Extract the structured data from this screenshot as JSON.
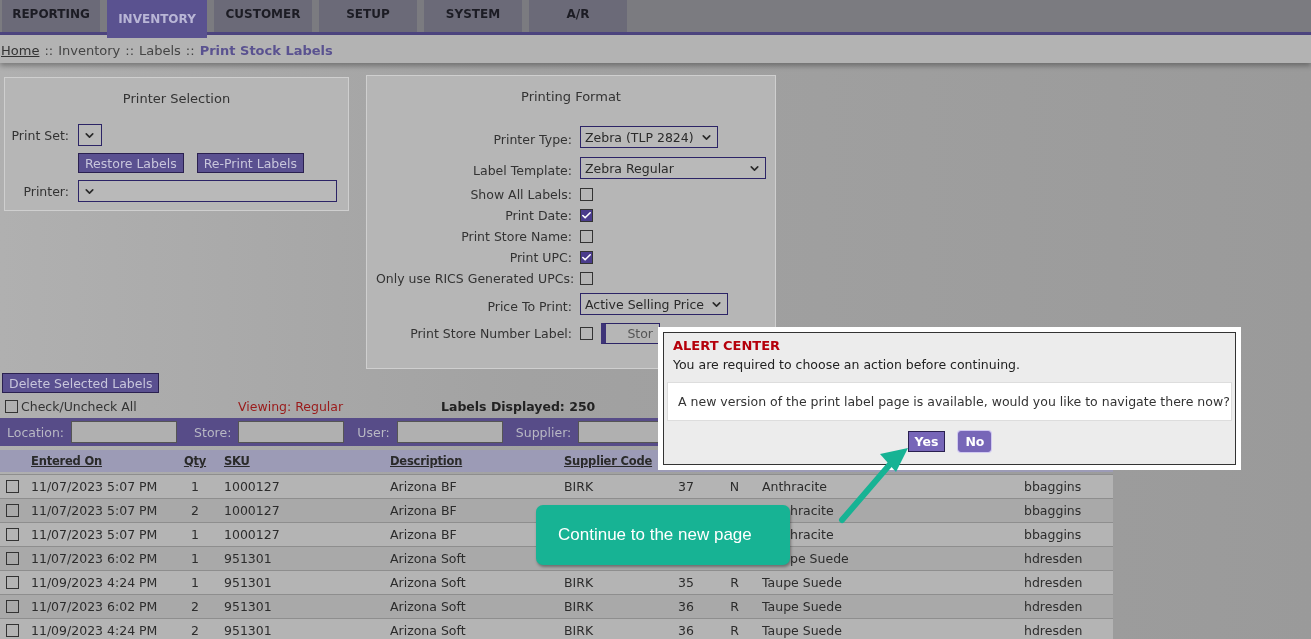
{
  "tabs": [
    {
      "label": "REPORTING",
      "selected": false
    },
    {
      "label": "INVENTORY",
      "selected": true
    },
    {
      "label": "CUSTOMER",
      "selected": false
    },
    {
      "label": "SETUP",
      "selected": false
    },
    {
      "label": "SYSTEM",
      "selected": false
    },
    {
      "label": "A/R",
      "selected": false
    }
  ],
  "breadcrumb": [
    {
      "kind": "link",
      "text": "Home"
    },
    {
      "kind": "separator",
      "text": "::"
    },
    {
      "kind": "plain",
      "text": "Inventory"
    },
    {
      "kind": "separator",
      "text": "::"
    },
    {
      "kind": "plain",
      "text": "Labels"
    },
    {
      "kind": "separator",
      "text": "::"
    },
    {
      "kind": "current",
      "text": "Print Stock Labels"
    }
  ],
  "printer_selection": {
    "title": "Printer Selection",
    "print_set_label": "Print Set:",
    "buttons": [
      "Restore Labels",
      "Re-Print Labels"
    ],
    "printer_label": "Printer:"
  },
  "printing_format": {
    "title": "Printing Format",
    "fields": [
      {
        "kind": "select",
        "label": "Printer Type:",
        "value": "Zebra (TLP 2824)"
      },
      {
        "kind": "wide_select",
        "label": "Label Template:",
        "value": "Zebra Regular"
      },
      {
        "kind": "checkbox",
        "label": "Show All Labels:",
        "checked": false
      },
      {
        "kind": "checkbox",
        "label": "Print Date:",
        "checked": true
      },
      {
        "kind": "checkbox",
        "label": "Print Store Name:",
        "checked": false
      },
      {
        "kind": "checkbox",
        "label": "Print UPC:",
        "checked": true
      },
      {
        "kind": "checkbox",
        "label": "Only use RICS Generated UPCs:",
        "checked": false
      },
      {
        "kind": "select",
        "label": "Price To Print:",
        "value": "Active Selling Price"
      },
      {
        "kind": "checkbox_button",
        "label": "Print Store Number Label:",
        "checked": false,
        "button": "Stor"
      }
    ]
  },
  "actions": {
    "delete_button": "Delete Selected Labels",
    "check_all": {
      "label": "Check/Uncheck All",
      "checked": false
    },
    "viewing": "Viewing: Regular",
    "displayed": "Labels Displayed: 250"
  },
  "filters": [
    "Location:",
    "Store:",
    "User:",
    "Supplier:"
  ],
  "table": {
    "columns": [
      "Entered On",
      "Qty",
      "SKU",
      "Description",
      "Supplier Code"
    ],
    "rows": [
      {
        "checked": false,
        "color_cut": false,
        "cells": [
          "11/07/2023 5:07 PM",
          "1",
          "1000127",
          "Arizona BF",
          "BIRK",
          "37",
          "N",
          "Anthracite",
          "bbaggins"
        ]
      },
      {
        "checked": false,
        "color_cut": true,
        "cells": [
          "11/07/2023 5:07 PM",
          "2",
          "1000127",
          "Arizona BF",
          null,
          null,
          null,
          "hracite",
          "bbaggins"
        ]
      },
      {
        "checked": false,
        "color_cut": true,
        "cells": [
          "11/07/2023 5:07 PM",
          "1",
          "1000127",
          "Arizona BF",
          null,
          null,
          null,
          "hracite",
          "bbaggins"
        ]
      },
      {
        "checked": false,
        "color_cut": true,
        "cells": [
          "11/07/2023 6:02 PM",
          "1",
          "951301",
          "Arizona Soft",
          null,
          null,
          null,
          "pe Suede",
          "hdresden"
        ]
      },
      {
        "checked": false,
        "color_cut": false,
        "cells": [
          "11/09/2023 4:24 PM",
          "1",
          "951301",
          "Arizona Soft",
          "BIRK",
          "35",
          "R",
          "Taupe Suede",
          "hdresden"
        ]
      },
      {
        "checked": false,
        "color_cut": false,
        "cells": [
          "11/07/2023 6:02 PM",
          "2",
          "951301",
          "Arizona Soft",
          "BIRK",
          "36",
          "R",
          "Taupe Suede",
          "hdresden"
        ]
      },
      {
        "checked": false,
        "color_cut": false,
        "cells": [
          "11/09/2023 4:24 PM",
          "2",
          "951301",
          "Arizona Soft",
          "BIRK",
          "36",
          "R",
          "Taupe Suede",
          "hdresden"
        ]
      }
    ]
  },
  "alert": {
    "title": "ALERT CENTER",
    "subtitle": "You are required to choose an action before continuing.",
    "message": "A new version of the print label page is available, would you like to navigate there now?",
    "buttons": [
      "Yes",
      "No"
    ]
  },
  "callout": {
    "text": "Continue to the new page"
  }
}
